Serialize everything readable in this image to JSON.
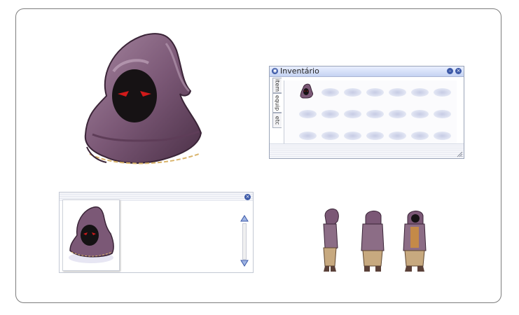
{
  "inventory": {
    "title": "Inventário",
    "tabs": [
      {
        "label": "item",
        "active": false
      },
      {
        "label": "equip",
        "active": true
      },
      {
        "label": "etc",
        "active": false
      }
    ],
    "icons": {
      "title": "window-icon",
      "minimize": "minimize-icon",
      "close": "close-icon",
      "item": "hood-item-icon",
      "resize": "resize-grip-icon"
    },
    "slots": 21,
    "filled_slots": 1
  },
  "description": {
    "icons": {
      "close": "close-icon",
      "up": "scroll-up-icon",
      "down": "scroll-down-icon"
    },
    "text": ""
  },
  "colors": {
    "hood_dark": "#4e3348",
    "hood_mid": "#7c5a76",
    "hood_light": "#a887a0",
    "accent_blue": "#3d5aa8",
    "eye_red": "#d11a1a"
  }
}
